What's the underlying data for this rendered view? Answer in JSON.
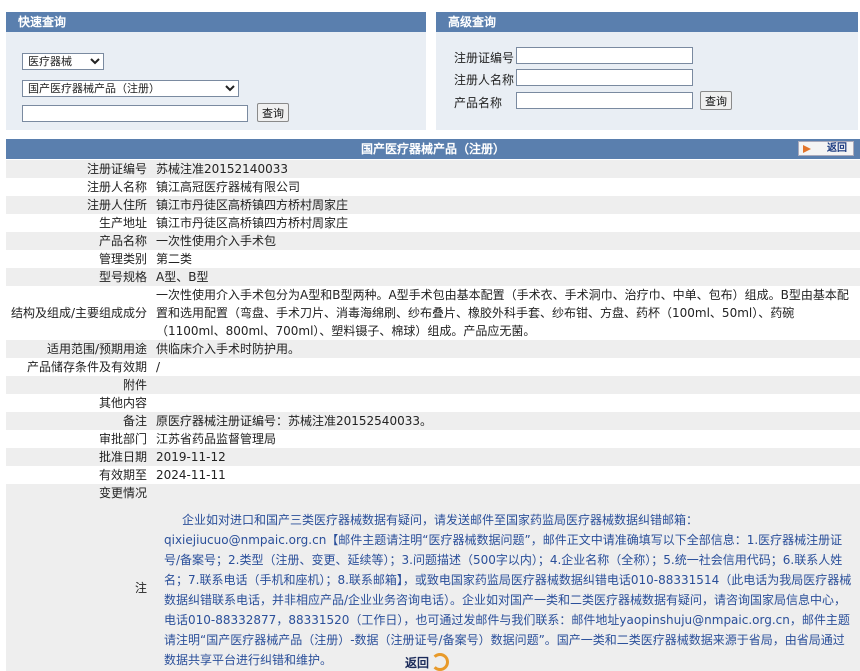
{
  "quick_search": {
    "title": "快速查询",
    "category_select": "医疗器械",
    "type_select": "国产医疗器械产品（注册）",
    "keyword_value": "",
    "search_button": "查询"
  },
  "advanced_search": {
    "title": "高级查询",
    "fields": [
      {
        "label": "注册证编号",
        "value": ""
      },
      {
        "label": "注册人名称",
        "value": ""
      },
      {
        "label": "产品名称",
        "value": ""
      }
    ],
    "search_button": "查询"
  },
  "detail": {
    "title": "国产医疗器械产品（注册）",
    "back_label": "返回",
    "rows": [
      {
        "key": "注册证编号",
        "value": "苏械注准20152140033"
      },
      {
        "key": "注册人名称",
        "value": "镇江高冠医疗器械有限公司"
      },
      {
        "key": "注册人住所",
        "value": "镇江市丹徒区高桥镇四方桥村周家庄"
      },
      {
        "key": "生产地址",
        "value": "镇江市丹徒区高桥镇四方桥村周家庄"
      },
      {
        "key": "产品名称",
        "value": "一次性使用介入手术包"
      },
      {
        "key": "管理类别",
        "value": "第二类"
      },
      {
        "key": "型号规格",
        "value": "A型、B型"
      },
      {
        "key": "结构及组成/主要组成成分",
        "value": "一次性使用介入手术包分为A型和B型两种。A型手术包由基本配置（手术衣、手术洞巾、治疗巾、中单、包布）组成。B型由基本配置和选用配置（弯盘、手术刀片、消毒海绵刷、纱布叠片、橡胶外科手套、纱布钳、方盘、药杯（100ml、50ml）、药碗（1100ml、800ml、700ml）、塑料镊子、棉球）组成。产品应无菌。"
      },
      {
        "key": "适用范围/预期用途",
        "value": "供临床介入手术时防护用。"
      },
      {
        "key": "产品储存条件及有效期",
        "value": "/"
      },
      {
        "key": "附件",
        "value": ""
      },
      {
        "key": "其他内容",
        "value": ""
      },
      {
        "key": "备注",
        "value": "原医疗器械注册证编号：苏械注准20152540033。"
      },
      {
        "key": "审批部门",
        "value": "江苏省药品监督管理局"
      },
      {
        "key": "批准日期",
        "value": "2019-11-12"
      },
      {
        "key": "有效期至",
        "value": "2024-11-11"
      },
      {
        "key": "变更情况",
        "value": ""
      }
    ],
    "note_key": "注",
    "note_text": "企业如对进口和国产三类医疗器械数据有疑问，请发送邮件至国家药监局医疗器械数据纠错邮箱：qixiejiucuo@nmpaic.org.cn【邮件主题请注明“医疗器械数据问题”，邮件正文中请准确填写以下全部信息：1.医疗器械注册证号/备案号；2.类型（注册、变更、延续等）；3.问题描述（500字以内）；4.企业名称（全称）；5.统一社会信用代码；6.联系人姓名；7.联系电话（手机和座机）；8.联系邮箱】，或致电国家药监局医疗器械数据纠错电话010-88331514（此电话为我局医疗器械数据纠错联系电话，并非相应产品/企业业务咨询电话）。企业如对国产一类和二类医疗器械数据有疑问，请咨询国家局信息中心，电话010-88332877，88331520（工作日），也可通过发邮件与我们联系：邮件地址yaopinshuju@nmpaic.org.cn，邮件主题请注明“国产医疗器械产品（注册）-数据（注册证号/备案号）数据问题”。国产一类和二类医疗器械数据来源于省局，由省局通过数据共享平台进行纠错和维护。",
    "bottom_back_label": "返回"
  }
}
